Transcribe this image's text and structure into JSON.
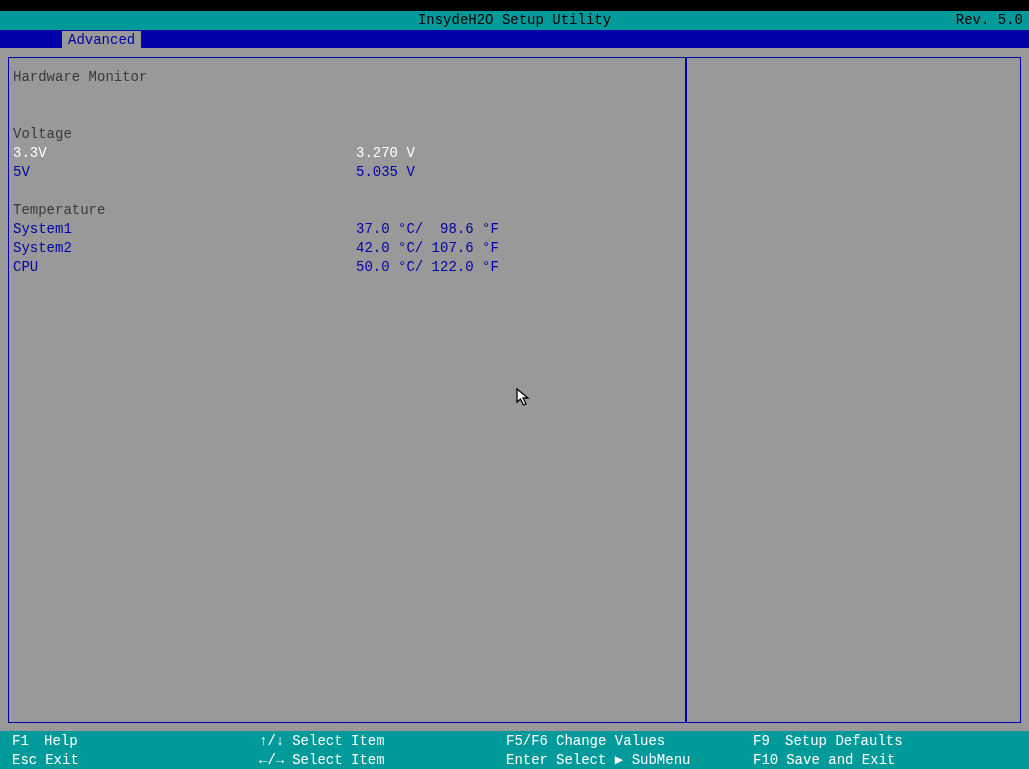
{
  "window": {
    "title": "InsydeH2O Setup Utility",
    "revision": "Rev. 5.0"
  },
  "tabs": [
    {
      "label": "Advanced",
      "selected": true
    }
  ],
  "page_title": "Hardware Monitor",
  "rows": [
    {
      "kind": "heading",
      "label": "Voltage"
    },
    {
      "kind": "item",
      "label": "3.3V",
      "value": "3.270 V",
      "selected": true
    },
    {
      "kind": "item",
      "label": "5V",
      "value": "5.035 V",
      "selected": false
    },
    {
      "kind": "spacer"
    },
    {
      "kind": "heading",
      "label": "Temperature"
    },
    {
      "kind": "item",
      "label": "System1",
      "value": "37.0 °C/  98.6 °F",
      "selected": false
    },
    {
      "kind": "item",
      "label": "System2",
      "value": "42.0 °C/ 107.6 °F",
      "selected": false
    },
    {
      "kind": "item",
      "label": "CPU",
      "value": "50.0 °C/ 122.0 °F",
      "selected": false
    }
  ],
  "footer": [
    [
      {
        "key": "F1",
        "label": "Help"
      },
      {
        "key": "Esc",
        "label": "Exit"
      }
    ],
    [
      {
        "key": "↑/↓",
        "label": "Select Item"
      },
      {
        "key": "←/→",
        "label": "Select Item"
      }
    ],
    [
      {
        "key": "F5/F6",
        "label": "Change Values"
      },
      {
        "key": "Enter",
        "label": "Select ▶ SubMenu"
      }
    ],
    [
      {
        "key": "F9",
        "label": "Setup Defaults"
      },
      {
        "key": "F10",
        "label": "Save and Exit"
      }
    ]
  ]
}
